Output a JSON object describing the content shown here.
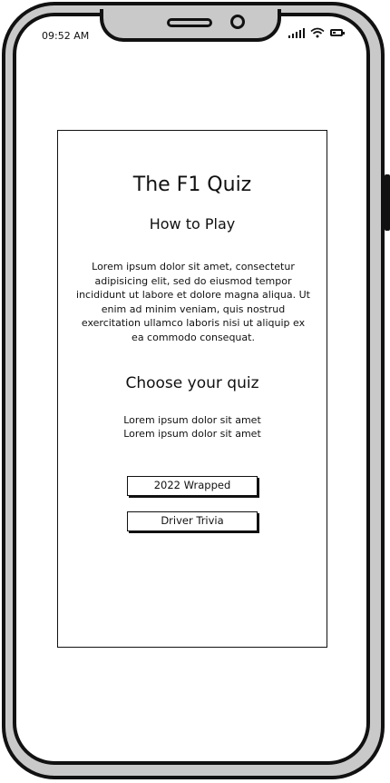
{
  "status_bar": {
    "time": "09:52 AM",
    "signal_icon": "signal-icon",
    "wifi_icon": "wifi-icon",
    "battery_icon": "battery-icon",
    "battery_level": 0.5
  },
  "app": {
    "title": "The F1 Quiz",
    "subtitle": "How to Play",
    "instructions": "Lorem ipsum dolor sit amet, consectetur adipisicing elit, sed do eiusmod tempor incididunt ut labore et dolore magna aliqua. Ut enim ad minim veniam, quis nostrud exercitation ullamco laboris nisi ut aliquip ex ea commodo consequat.",
    "choose_heading": "Choose your quiz",
    "choose_lines": [
      "Lorem ipsum dolor sit amet",
      "Lorem ipsum dolor sit amet"
    ],
    "quiz_buttons": [
      {
        "label": "2022 Wrapped"
      },
      {
        "label": "Driver Trivia"
      }
    ]
  }
}
